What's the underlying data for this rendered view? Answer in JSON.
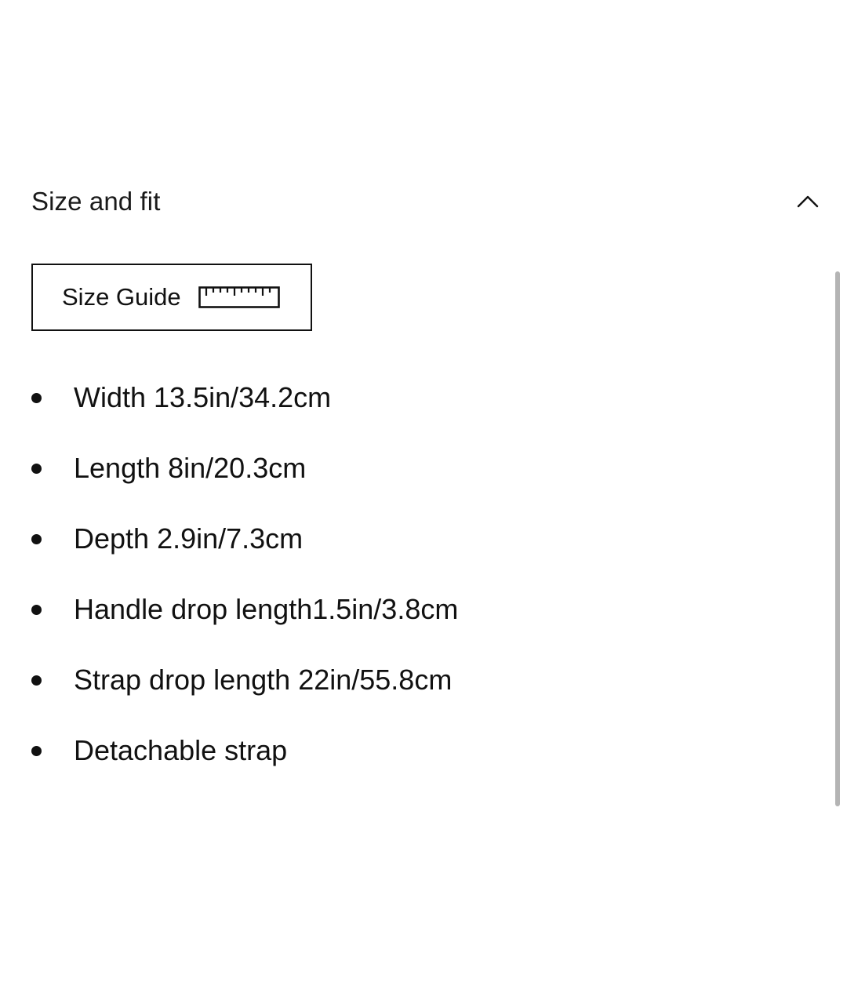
{
  "section": {
    "title": "Size and fit",
    "expanded": true,
    "toggle_icon": "chevron-up-icon"
  },
  "size_guide": {
    "label": "Size Guide",
    "icon": "ruler-icon"
  },
  "specs": [
    "Width 13.5in/34.2cm",
    "Length 8in/20.3cm",
    "Depth 2.9in/7.3cm",
    "Handle drop length1.5in/3.8cm",
    "Strap drop length 22in/55.8cm",
    "Detachable strap"
  ],
  "colors": {
    "text": "#111111",
    "background": "#ffffff",
    "scrollbar": "#b4b4b4"
  }
}
